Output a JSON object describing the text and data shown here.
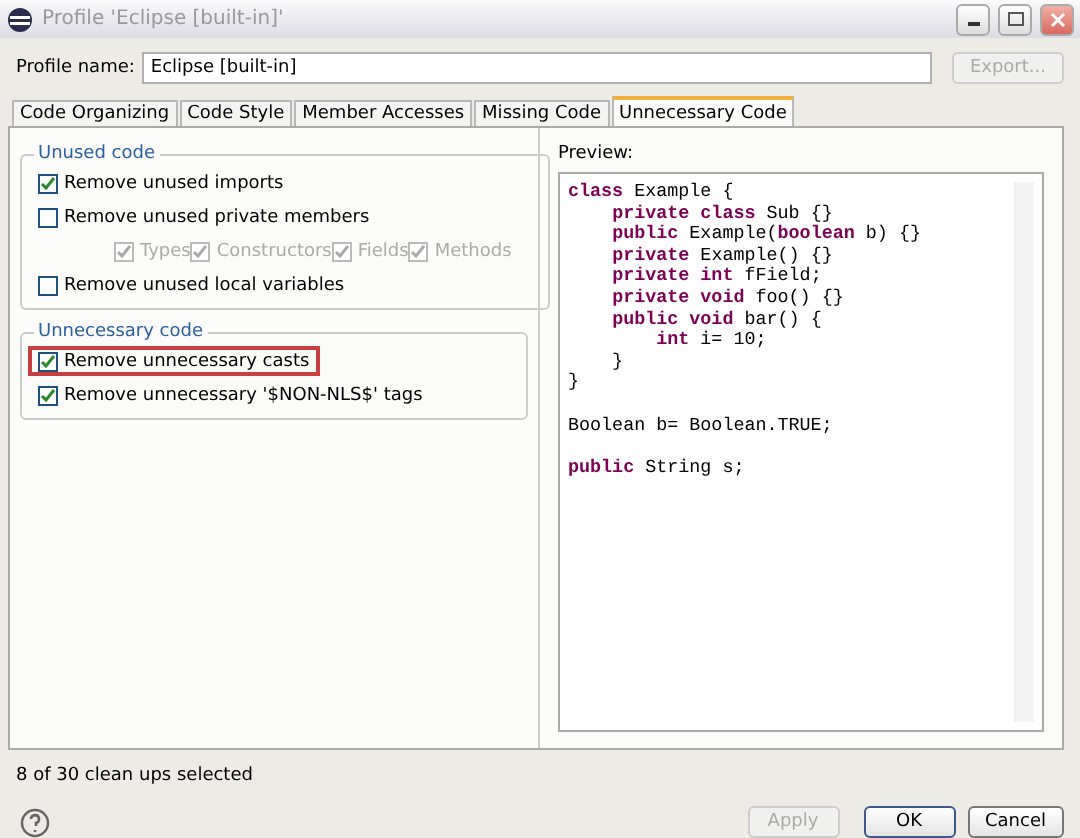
{
  "window": {
    "title": "Profile 'Eclipse [built-in]'"
  },
  "profile": {
    "label": "Profile name:",
    "value": "Eclipse [built-in]",
    "export_button": {
      "label": "Export...",
      "disabled": true
    }
  },
  "tabs": [
    {
      "label": "Code Organizing",
      "selected": false
    },
    {
      "label": "Code Style",
      "selected": false
    },
    {
      "label": "Member Accesses",
      "selected": false
    },
    {
      "label": "Missing Code",
      "selected": false
    },
    {
      "label": "Unnecessary Code",
      "selected": true
    }
  ],
  "groups": [
    {
      "title": "Unused code",
      "options": [
        {
          "label": "Remove unused imports",
          "checked": true,
          "highlighted": false
        },
        {
          "label": "Remove unused private members",
          "checked": false,
          "highlighted": false,
          "children": [
            {
              "label": "Types",
              "checked": true,
              "disabled": true
            },
            {
              "label": "Constructors",
              "checked": true,
              "disabled": true
            },
            {
              "label": "Fields",
              "checked": true,
              "disabled": true
            },
            {
              "label": "Methods",
              "checked": true,
              "disabled": true
            }
          ]
        },
        {
          "label": "Remove unused local variables",
          "checked": false,
          "highlighted": false
        }
      ]
    },
    {
      "title": "Unnecessary code",
      "options": [
        {
          "label": "Remove unnecessary casts",
          "checked": true,
          "highlighted": true
        },
        {
          "label": "Remove unnecessary '$NON-NLS$' tags",
          "checked": true,
          "highlighted": false
        }
      ]
    }
  ],
  "preview": {
    "label": "Preview:",
    "blocks": [
      [
        "**class** Example {",
        "    **private class** Sub {}",
        "    **public** Example(**boolean** b) {}",
        "    **private** Example() {}",
        "    **private int** fField;",
        "    **private void** foo() {}",
        "    **public void** bar() {",
        "        **int** i= 10;",
        "    }",
        "}"
      ],
      [
        "Boolean b= Boolean.TRUE;"
      ],
      [
        "**public** String s;"
      ]
    ]
  },
  "status": "8 of 30 clean ups selected",
  "buttons": [
    {
      "label": "Apply",
      "disabled": true,
      "default": false
    },
    {
      "label": "OK",
      "disabled": false,
      "default": true
    },
    {
      "label": "Cancel",
      "disabled": false,
      "default": false
    }
  ]
}
